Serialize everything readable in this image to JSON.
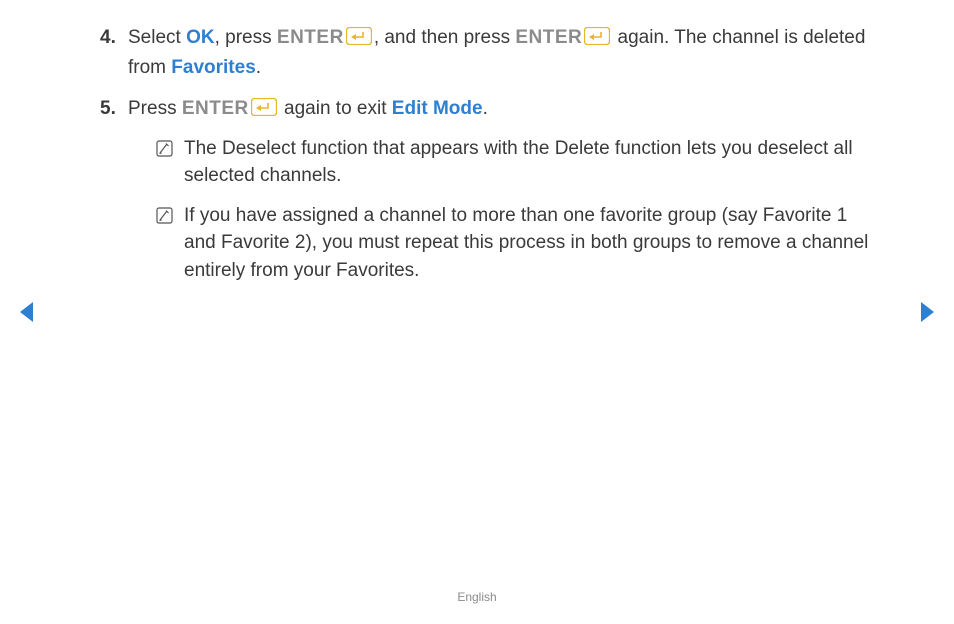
{
  "steps": [
    {
      "segments": [
        {
          "text": "Select ",
          "class": ""
        },
        {
          "text": "OK",
          "class": "blue"
        },
        {
          "text": ", press ",
          "class": ""
        },
        {
          "text": "ENTER",
          "class": "gray-bold"
        },
        {
          "icon": "enter"
        },
        {
          "text": ", and then press ",
          "class": ""
        },
        {
          "text": "ENTER",
          "class": "gray-bold"
        },
        {
          "icon": "enter"
        },
        {
          "text": " again. The channel is deleted from ",
          "class": ""
        },
        {
          "text": "Favorites",
          "class": "blue"
        },
        {
          "text": ".",
          "class": ""
        }
      ]
    },
    {
      "segments": [
        {
          "text": "Press ",
          "class": ""
        },
        {
          "text": "ENTER",
          "class": "gray-bold"
        },
        {
          "icon": "enter"
        },
        {
          "text": " again to exit ",
          "class": ""
        },
        {
          "text": "Edit Mode",
          "class": "blue"
        },
        {
          "text": ".",
          "class": ""
        }
      ]
    }
  ],
  "notes": [
    "The Deselect function that appears with the Delete function lets you deselect all selected channels.",
    "If you have assigned a channel to more than one favorite group (say Favorite 1 and Favorite 2), you must repeat this process in both groups to remove a channel entirely from your Favorites."
  ],
  "footer": "English",
  "icons": {
    "enter_name": "enter-icon",
    "note_name": "note-icon",
    "prev_name": "nav-prev-arrow",
    "next_name": "nav-next-arrow"
  }
}
